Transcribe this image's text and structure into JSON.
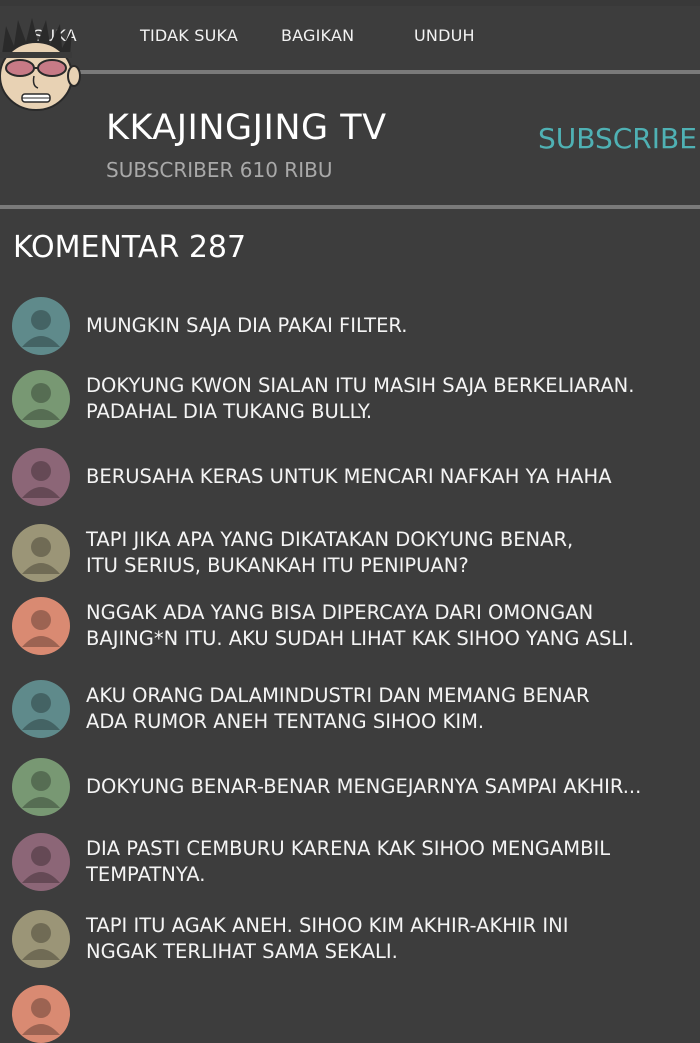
{
  "actions": {
    "like": "SUKA",
    "dislike": "TIDAK SUKA",
    "share": "BAGIKAN",
    "download": "UNDUH"
  },
  "channel": {
    "name": "KKAJINGJING TV",
    "subscribers": "SUBSCRIBER 610 RIBU",
    "subscribe_label": "SUBSCRIBE",
    "avatar_icon": "cartoon-face-with-sunglasses"
  },
  "comments": {
    "title": "KOMENTAR 287",
    "items": [
      {
        "avatar_color": "#5f8a8b",
        "lines": [
          "MUNGKIN SAJA DIA PAKAI FILTER."
        ]
      },
      {
        "avatar_color": "#789873",
        "lines": [
          "DOKYUNG KWON SIALAN ITU MASIH SAJA BERKELIARAN.",
          "PADAHAL DIA TUKANG BULLY."
        ]
      },
      {
        "avatar_color": "#8c6677",
        "lines": [
          "BERUSAHA KERAS UNTUK MENCARI NAFKAH YA HAHA"
        ]
      },
      {
        "avatar_color": "#9b9577",
        "lines": [
          "TAPI JIKA APA YANG DIKATAKAN DOKYUNG BENAR,",
          "ITU SERIUS, BUKANKAH ITU PENIPUAN?"
        ]
      },
      {
        "avatar_color": "#d98a72",
        "lines": [
          "NGGAK ADA YANG BISA DIPERCAYA DARI OMONGAN",
          "BAJING*N ITU. AKU SUDAH LIHAT KAK SIHOO YANG ASLI."
        ]
      },
      {
        "avatar_color": "#5f8a8b",
        "lines": [
          "AKU ORANG DALAMINDUSTRI DAN MEMANG BENAR",
          "ADA RUMOR ANEH TENTANG SIHOO KIM."
        ]
      },
      {
        "avatar_color": "#789873",
        "lines": [
          "DOKYUNG BENAR-BENAR MENGEJARNYA SAMPAI AKHIR..."
        ]
      },
      {
        "avatar_color": "#8c6677",
        "lines": [
          "DIA PASTI CEMBURU KARENA KAK SIHOO MENGAMBIL",
          "TEMPATNYA."
        ]
      },
      {
        "avatar_color": "#9b9577",
        "lines": [
          "TAPI ITU AGAK ANEH. SIHOO KIM AKHIR-AKHIR INI",
          "NGGAK TERLIHAT SAMA SEKALI."
        ]
      },
      {
        "avatar_color": "#d98a72",
        "lines": []
      }
    ]
  }
}
